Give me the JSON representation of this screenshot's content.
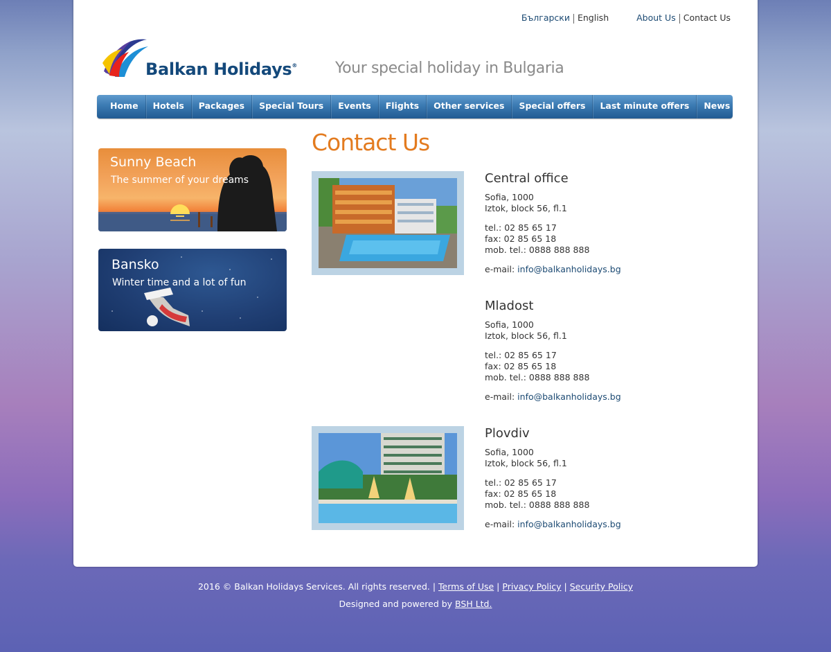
{
  "top_links": {
    "lang_bg": "Български",
    "lang_en": "English",
    "about": "About Us",
    "contact": "Contact Us"
  },
  "logo": {
    "brand": "Balkan Holidays",
    "reg": "®"
  },
  "tagline": "Your special holiday in Bulgaria",
  "nav": [
    "Home",
    "Hotels",
    "Packages",
    "Special Tours",
    "Events",
    "Flights",
    "Other services",
    "Special offers",
    "Last minute offers",
    "News"
  ],
  "banners": [
    {
      "title": "Sunny Beach",
      "subtitle": "The summer of your dreams"
    },
    {
      "title": "Bansko",
      "subtitle": "Winter time and a lot of fun"
    }
  ],
  "page_title": "Contact Us",
  "offices": [
    {
      "name": "Central office",
      "city": "Sofia, 1000",
      "address": "Iztok, block 56, fl.1",
      "tel": "tel.: 02 85 65 17",
      "fax": "fax: 02 85 65 18",
      "mob": "mob. tel.: 0888 888 888",
      "email_label": "e-mail: ",
      "email": "info@balkanholidays.bg"
    },
    {
      "name": "Mladost",
      "city": "Sofia, 1000",
      "address": "Iztok, block 56, fl.1",
      "tel": "tel.: 02 85 65 17",
      "fax": "fax: 02 85 65 18",
      "mob": "mob. tel.: 0888 888 888",
      "email_label": "e-mail: ",
      "email": "info@balkanholidays.bg"
    },
    {
      "name": "Plovdiv",
      "city": "Sofia, 1000",
      "address": "Iztok, block 56, fl.1",
      "tel": "tel.: 02 85 65 17",
      "fax": "fax: 02 85 65 18",
      "mob": "mob. tel.: 0888 888 888",
      "email_label": "e-mail: ",
      "email": "info@balkanholidays.bg"
    }
  ],
  "footer": {
    "copyright": "2016 © Balkan Holidays Services. All rights reserved. | ",
    "terms": "Terms of Use",
    "sep": " | ",
    "privacy": "Privacy Policy",
    "security": "Security Policy",
    "designed": "Designed and powered by ",
    "bsh": "BSH Ltd."
  }
}
